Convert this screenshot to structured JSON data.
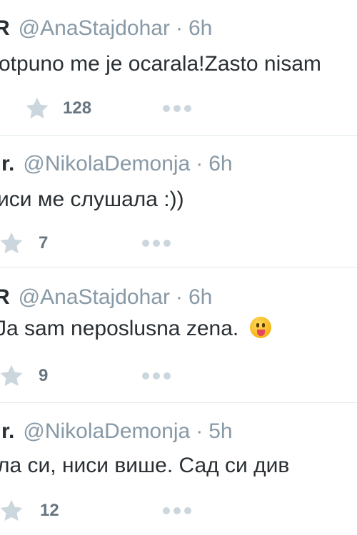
{
  "tweets": [
    {
      "name": "R",
      "handle": "@AnaStajdohar",
      "separator": "·",
      "time": "6h",
      "text": "otpuno me je ocarala!Zasto nisam",
      "favorites": "128",
      "emoji": null
    },
    {
      "name": "r.",
      "handle": "@NikolaDemonja",
      "separator": "·",
      "time": "6h",
      "text": "иси ме слушала :))",
      "favorites": "7",
      "emoji": null
    },
    {
      "name": "R",
      "handle": "@AnaStajdohar",
      "separator": "·",
      "time": "6h",
      "text": "Ja sam neposlusna zena.",
      "favorites": "9",
      "emoji": "tongue-face"
    },
    {
      "name": "r.",
      "handle": "@NikolaDemonja",
      "separator": "·",
      "time": "5h",
      "text": "ла си, ниси више. Сад си див",
      "favorites": "12",
      "emoji": null
    }
  ],
  "icons": {
    "favorite": "star-icon",
    "more": "more-dots-icon"
  },
  "colors": {
    "text": "#292f33",
    "muted": "#8899a6",
    "icon": "#ccd6dd",
    "count": "#66757f",
    "divider": "#e1e8ed"
  }
}
